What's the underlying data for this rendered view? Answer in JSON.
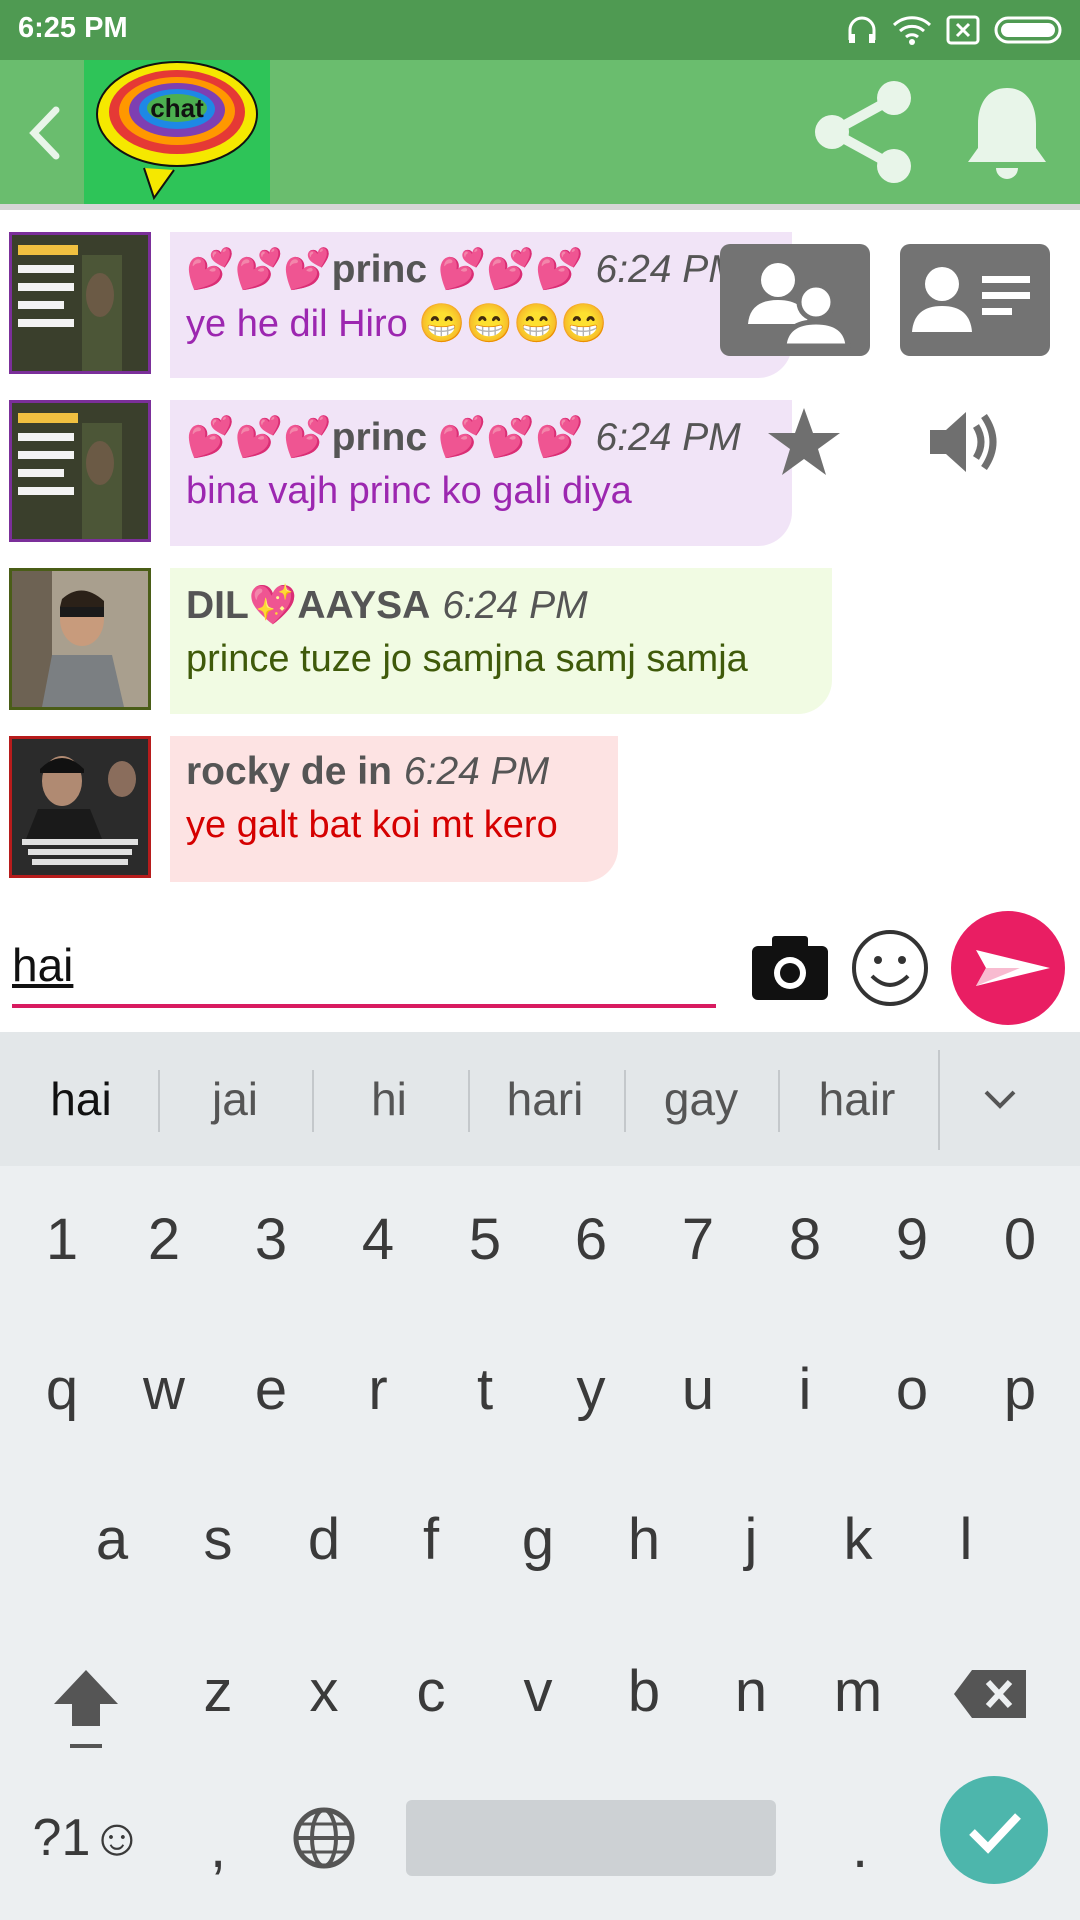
{
  "status_bar": {
    "time": "6:25 PM",
    "icons": [
      "headphones-icon",
      "wifi-icon",
      "no-sim-icon",
      "battery-icon"
    ]
  },
  "header": {
    "logo_text": "chat",
    "icons": [
      "back-arrow-icon",
      "share-icon",
      "bell-icon"
    ],
    "color": "#6abd6e"
  },
  "overlay_actions": [
    "group-icon",
    "profile-card-icon",
    "star-icon",
    "speaker-icon"
  ],
  "messages": [
    {
      "sender": "💕💕💕princ 💕💕💕",
      "time": "6:24 PM",
      "text": "ye he dil Hiro 😁😁😁😁",
      "bubble_color": "#f1e4f7",
      "text_color": "#9c27b0",
      "border_color": "#7b2f9a"
    },
    {
      "sender": "💕💕💕princ 💕💕💕",
      "time": "6:24 PM",
      "text": "bina vajh princ ko gali diya",
      "bubble_color": "#f1e4f7",
      "text_color": "#9c27b0",
      "border_color": "#7b2f9a"
    },
    {
      "sender": "DIL💖AAYSA",
      "time": "6:24 PM",
      "text": "prince tuze jo samjna samj samja",
      "bubble_color": "#f1fbe3",
      "text_color": "#3f5a0a",
      "border_color": "#4a5d17"
    },
    {
      "sender": "rocky de in",
      "time": "6:24 PM",
      "text": "ye galt bat koi mt kero",
      "bubble_color": "#fde3e3",
      "text_color": "#d50000",
      "border_color": "#b71c1c"
    }
  ],
  "composer": {
    "value": "hai",
    "icons": [
      "camera-icon",
      "emoji-icon",
      "send-icon"
    ],
    "accent": "#d81b60"
  },
  "keyboard": {
    "suggestions": [
      "hai",
      "jai",
      "hi",
      "hari",
      "gay",
      "hair"
    ],
    "row_numbers": [
      "1",
      "2",
      "3",
      "4",
      "5",
      "6",
      "7",
      "8",
      "9",
      "0"
    ],
    "row_1": [
      "q",
      "w",
      "e",
      "r",
      "t",
      "y",
      "u",
      "i",
      "o",
      "p"
    ],
    "row_2": [
      "a",
      "s",
      "d",
      "f",
      "g",
      "h",
      "j",
      "k",
      "l"
    ],
    "row_3": [
      "z",
      "x",
      "c",
      "v",
      "b",
      "n",
      "m"
    ],
    "symbols_key": "?1☺",
    "comma_key": ",",
    "period_key": ".",
    "enter_color": "#4db6ac"
  }
}
